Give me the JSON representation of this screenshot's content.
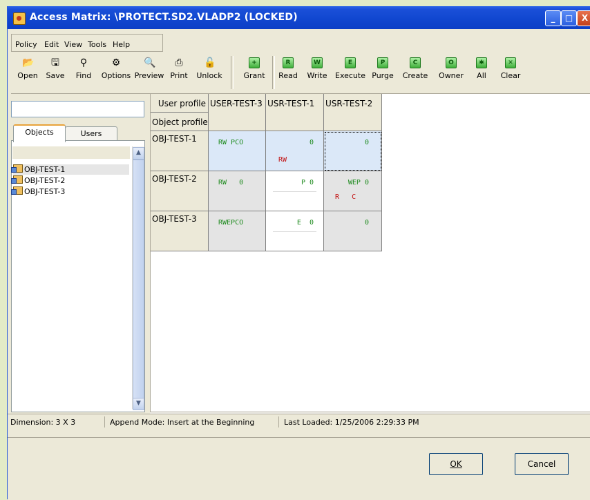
{
  "window": {
    "title": "Access Matrix: \\PROTECT.SD2.VLADP2 (LOCKED)",
    "controls": [
      "_",
      "□",
      "X"
    ]
  },
  "menu": [
    "Policy",
    "Edit",
    "View",
    "Tools",
    "Help"
  ],
  "toolbar": [
    {
      "label": "Open",
      "icon": "folder-open-icon",
      "glyph": "📂"
    },
    {
      "label": "Save",
      "icon": "floppy-disk-icon",
      "glyph": "🖫"
    },
    {
      "label": "Find",
      "icon": "binoculars-icon",
      "glyph": "⚲"
    },
    {
      "label": "Options",
      "icon": "options-icon",
      "glyph": "⚙"
    },
    {
      "label": "Preview",
      "icon": "print-preview-icon",
      "glyph": "🔍"
    },
    {
      "label": "Print",
      "icon": "printer-icon",
      "glyph": "⎙"
    },
    {
      "label": "Unlock",
      "icon": "unlock-icon",
      "glyph": "🔓"
    },
    {
      "label": "Grant",
      "icon": "grant-icon",
      "glyph": "+"
    },
    {
      "label": "Read",
      "icon": "read-permission-icon",
      "glyph": "R"
    },
    {
      "label": "Write",
      "icon": "write-permission-icon",
      "glyph": "W"
    },
    {
      "label": "Execute",
      "icon": "execute-permission-icon",
      "glyph": "E"
    },
    {
      "label": "Purge",
      "icon": "purge-permission-icon",
      "glyph": "P"
    },
    {
      "label": "Create",
      "icon": "create-permission-icon",
      "glyph": "C"
    },
    {
      "label": "Owner",
      "icon": "owner-permission-icon",
      "glyph": "O"
    },
    {
      "label": "All",
      "icon": "all-permissions-icon",
      "glyph": "✱"
    },
    {
      "label": "Clear",
      "icon": "clear-icon",
      "glyph": "✕"
    }
  ],
  "left_panel": {
    "search_value": "",
    "tabs": [
      "Objects",
      "Users"
    ],
    "active_tab": "Objects",
    "objects": [
      "OBJ-TEST-1",
      "OBJ-TEST-2",
      "OBJ-TEST-3"
    ],
    "selected_object": "OBJ-TEST-1"
  },
  "matrix": {
    "corner_top": "User profile",
    "corner_bottom": "Object profile",
    "users": [
      "USER-TEST-3",
      "USR-TEST-1",
      "USR-TEST-2"
    ],
    "rows": [
      {
        "object": "OBJ-TEST-1",
        "cells": [
          {
            "top": "RW PCO",
            "bottom": ""
          },
          {
            "top": "0",
            "bottom": "RW"
          },
          {
            "top": "0",
            "bottom": ""
          }
        ]
      },
      {
        "object": "OBJ-TEST-2",
        "cells": [
          {
            "top": "RW   0",
            "bottom": ""
          },
          {
            "top": "P 0",
            "bottom": ""
          },
          {
            "top": "WEP 0",
            "bottom": "R   C"
          }
        ]
      },
      {
        "object": "OBJ-TEST-3",
        "cells": [
          {
            "top": "RWEPCO",
            "bottom": ""
          },
          {
            "top": "E  0",
            "bottom": ""
          },
          {
            "top": "0",
            "bottom": ""
          }
        ]
      }
    ],
    "colors": {
      "granted": "#1d8a1d",
      "denied": "#c21010",
      "selected_row": "#dbe8f8",
      "gray_cell": "#e4e4e4"
    }
  },
  "status": {
    "dimension": "Dimension: 3 X 3",
    "mode": "Append Mode: Insert at the Beginning",
    "loaded": "Last Loaded: 1/25/2006 2:29:33 PM"
  },
  "buttons": {
    "ok": "OK",
    "cancel": "Cancel"
  }
}
